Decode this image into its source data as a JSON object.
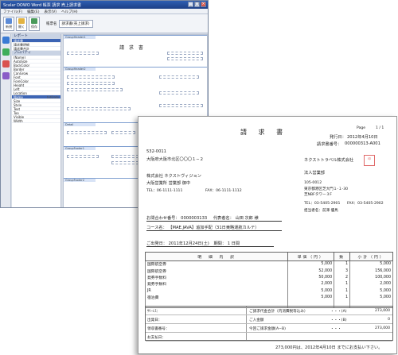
{
  "designer": {
    "title": "Scalar DOWO Word 帳票 請求 売上請求書",
    "menu": [
      "ファイル(F)",
      "編集(E)",
      "表示(V)",
      "ヘルプ(H)"
    ],
    "toolbar_buttons": [
      "新規",
      "開く",
      "保存"
    ],
    "report_name_label": "帳票名",
    "report_name_value": "請求書(売上請求)",
    "panel_report_header": "レポート",
    "panel_props_header": "プロパティ",
    "panel_rows": [
      {
        "name": "請求書",
        "value": ""
      },
      {
        "name": "請求書明細",
        "value": ""
      },
      {
        "name": "請求書合計",
        "value": ""
      }
    ],
    "prop_rows": [
      {
        "name": "(Name)",
        "value": ""
      },
      {
        "name": "AutoSize",
        "value": ""
      },
      {
        "name": "BackColor",
        "value": ""
      },
      {
        "name": "Border",
        "value": ""
      },
      {
        "name": "CanGrow",
        "value": ""
      },
      {
        "name": "Font",
        "value": ""
      },
      {
        "name": "ForeColor",
        "value": ""
      },
      {
        "name": "Height",
        "value": ""
      },
      {
        "name": "Left",
        "value": ""
      },
      {
        "name": "Location",
        "value": ""
      },
      {
        "name": "Name",
        "value": "txtDate"
      },
      {
        "name": "Size",
        "value": ""
      },
      {
        "name": "Style",
        "value": ""
      },
      {
        "name": "Text",
        "value": ""
      },
      {
        "name": "Top",
        "value": ""
      },
      {
        "name": "Visible",
        "value": ""
      },
      {
        "name": "Width",
        "value": ""
      }
    ],
    "band_labels": [
      "GroupHeader1",
      "GroupHeader2",
      "Detail",
      "GroupFooter1",
      "GroupFooter2"
    ],
    "canvas_title": "請 求 書"
  },
  "invoice": {
    "title": "請 求 書",
    "page_label": "Page",
    "page_value": "1 / 1",
    "issue_date_label": "発行日：",
    "issue_date": "2012年4月10日",
    "invoice_no_label": "請求書番号：",
    "invoice_no": "000000313-A001",
    "postal": "532-0011",
    "address": "大阪府大阪市北区〇〇〇１−２",
    "customer_company": "株式会社 ネクストヴィジョン",
    "customer_dept": "大阪営業所 営業部 御中",
    "customer_tel": "TEL：06-1111-1111",
    "customer_fax": "FAX：06-1111-1112",
    "issuer_company": "ネクストトラベル株式会社",
    "issuer_dept": "法人営業部",
    "issuer_postal": "105-0012",
    "issuer_address1": "東京都港区芝大門１-１-30",
    "issuer_address2": "芝NBFタワー３F",
    "issuer_tel": "TEL：03-5405-2901",
    "issuer_fax": "FAX：03-5405-2902",
    "issuer_rep": "担当者名：前澤 優馬",
    "inquiry_label": "お問合わせ番号：",
    "inquiry_no": "0000003133",
    "rep_label": "代表者名：",
    "rep_name": "山田 次郎 様",
    "course_label": "コース名：",
    "course_name": "【MAE.JAVA】追加手配（31日東略運航カルテ）",
    "depart_label": "ご出発日：",
    "depart_value": "2011年12月24日(土)",
    "period_label": "期間：",
    "period_value": "1 日間",
    "headers": [
      "明　細　内　訳",
      "単価（円）",
      "数",
      "小計（円）"
    ],
    "rows": [
      {
        "item": "国際航空券",
        "price": "5,000",
        "qty": "1",
        "subtotal": "5,000"
      },
      {
        "item": "国際航空券",
        "price": "52,000",
        "qty": "3",
        "subtotal": "156,000"
      },
      {
        "item": "発券手数料",
        "price": "50,000",
        "qty": "2",
        "subtotal": "100,000"
      },
      {
        "item": "発券手数料",
        "price": "2,000",
        "qty": "1",
        "subtotal": "2,000"
      },
      {
        "item": "JR",
        "price": "5,000",
        "qty": "1",
        "subtotal": "5,000"
      },
      {
        "item": "宿泊費",
        "price": "5,000",
        "qty": "1",
        "subtotal": "5,000"
      },
      {
        "item": "",
        "price": "",
        "qty": "",
        "subtotal": ""
      }
    ],
    "summary": [
      {
        "left": "ｻﾘｰﾚｽ：",
        "mid": "ご請求代金合計（内消費税等込み）",
        "mark": "・・・(A)",
        "amount": "273,000"
      },
      {
        "left": "出発日：",
        "mid": "ご入金額",
        "mark": "・・・(B)",
        "amount": "0"
      },
      {
        "left": "領収書番号：",
        "mid": "今回ご請求金額(A−B)",
        "mark": "・・・",
        "amount": "273,000"
      },
      {
        "left": "お支払日：",
        "mid": "",
        "mark": "",
        "amount": ""
      }
    ],
    "footer_note": "273,000円は、2012年4月10日 までにお支払い下さい。"
  }
}
